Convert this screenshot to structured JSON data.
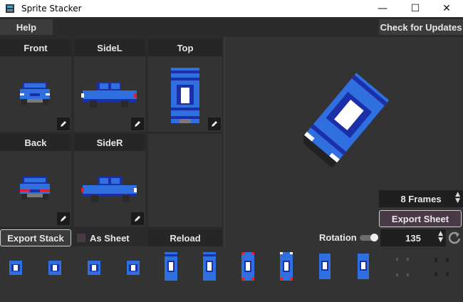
{
  "window": {
    "title": "Sprite Stacker",
    "minimize": "—",
    "maximize": "☐",
    "close": "✕"
  },
  "menubar": {
    "help": "Help",
    "check_updates": "Check for Updates"
  },
  "views": {
    "front": "Front",
    "sidel": "SideL",
    "top": "Top",
    "back": "Back",
    "sider": "SideR"
  },
  "buttons": {
    "export_stack": "Export Stack",
    "as_sheet": "As Sheet",
    "reload": "Reload",
    "export_sheet": "Export Sheet"
  },
  "controls": {
    "frames": "8 Frames",
    "rotation_label": "Rotation",
    "rotation_value": "135"
  },
  "colors": {
    "car_blue": "#2f6fe0",
    "car_dark": "#1a2fa8",
    "light": "#ffffff",
    "taillight": "#e02030",
    "background": "#333333"
  },
  "icons": {
    "edit": "pencil-icon",
    "reset": "reset-icon",
    "app": "app-icon"
  }
}
